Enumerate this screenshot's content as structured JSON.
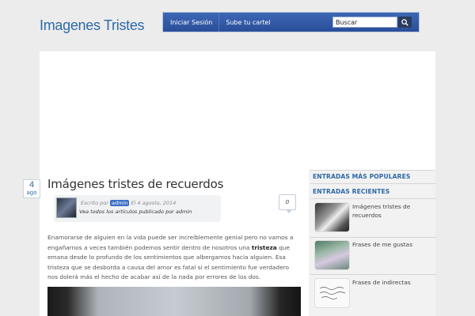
{
  "site": {
    "title": "Imagenes Tristes"
  },
  "nav": {
    "login": "Iniciar Sesión",
    "upload": "Sube tu cartel",
    "search_value": "Buscar"
  },
  "post": {
    "day": "4",
    "month": "ago",
    "title": "Imágenes tristes de recuerdos",
    "written_by": "Escrito por",
    "author": "admin",
    "date_text": "El 4 agosto, 2014",
    "all_posts": "Vea todos los artículos publicado por admin",
    "comments": "0",
    "body_1": "Enamorarse de alguien en la vida puede ser increíblemente genial pero no vamos a engañarnos a veces también podemos sentir dentro de nosotros una ",
    "body_bold": "tristeza",
    "body_2": " que emana desde lo profundo de los sentimientos que albergamos hacia alguien. Esa tristeza que se desborda a causa del amor es fatal si el sentimiento fue verdadero nos dolerá más el hecho de acabar así de la nada por errores de los dos."
  },
  "sidebar": {
    "popular_heading": "ENTRADAS MÁS POPULARES",
    "recent_heading": "ENTRADAS RECIENTES",
    "recent": [
      {
        "label": "Imágenes tristes de recuerdos"
      },
      {
        "label": "Frases de me gustas"
      },
      {
        "label": "Frases de indirectas"
      }
    ]
  },
  "colors": {
    "accent": "#2d6aa8",
    "nav_bg": "#2a4f99",
    "author_tag": "#3a6fc5"
  },
  "icons": {
    "search": "search-icon"
  }
}
